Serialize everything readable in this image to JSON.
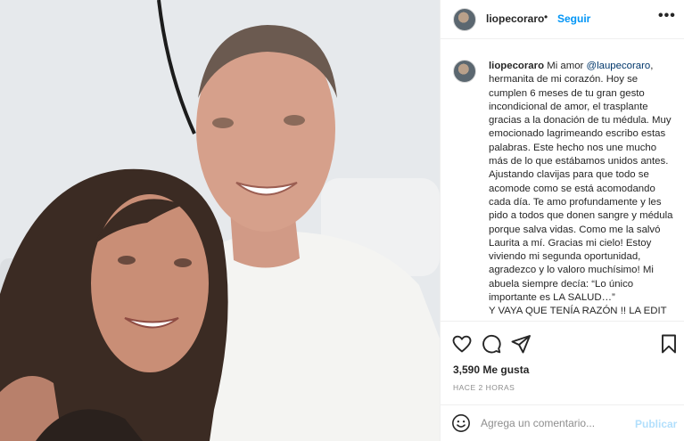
{
  "post": {
    "photo_alt": "",
    "username": "liopecoraro",
    "separator": "•",
    "follow_label": "Seguir",
    "more_label": "•••"
  },
  "caption": {
    "username": "liopecoraro",
    "intro": "Mi amor ",
    "mention": "@laupecoraro",
    "body": ", hermanita de mi corazón. Hoy se cumplen 6 meses de tu gran gesto incondicional de amor, el trasplante gracias a la donación de tu médula. Muy emocionado lagrimeando escribo estas palabras. Este hecho nos une mucho más de lo que estábamos unidos antes. Ajustando clavijas para que todo se acomode como se está acomodando cada día. Te amo profundamente y les pido a todos que donen sangre y médula porque salva vidas. Como me la salvó Laurita a mí. Gracias mi cielo! Estoy viviendo mi segunda oportunidad, agradezco y lo valoro muchísimo! Mi abuela siempre decía: “Lo único importante es LA SALUD…”",
    "cut_line": "Y VAYA QUE TENÍA RAZÓN !! LA EDIT"
  },
  "actions": {
    "like_icon": "heart-icon",
    "comment_icon": "comment-bubble-icon",
    "share_icon": "paper-plane-icon",
    "save_icon": "bookmark-icon"
  },
  "stats": {
    "likes": "3,590 Me gusta",
    "time": "HACE 2 HORAS"
  },
  "comment": {
    "emoji_icon": "smiley-icon",
    "placeholder": "Agrega un comentario...",
    "publish_label": "Publicar"
  },
  "colors": {
    "accent": "#0095f6",
    "publish_disabled": "#b2dffc",
    "muted": "#8e8e8e",
    "text": "#262626",
    "mention": "#00376b"
  }
}
